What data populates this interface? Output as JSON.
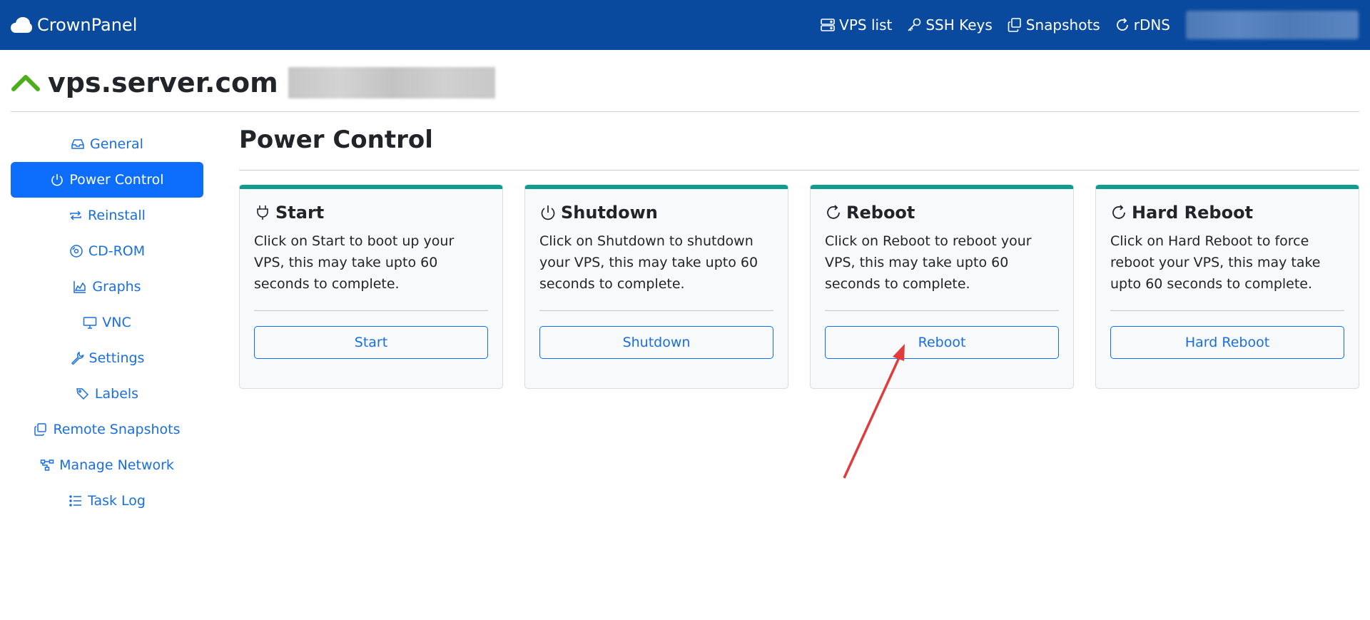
{
  "app": {
    "name": "CrownPanel"
  },
  "nav": {
    "links": [
      {
        "label": "VPS list",
        "icon": "server-icon"
      },
      {
        "label": "SSH Keys",
        "icon": "key-icon"
      },
      {
        "label": "Snapshots",
        "icon": "copy-icon"
      },
      {
        "label": "rDNS",
        "icon": "refresh-icon"
      }
    ]
  },
  "server": {
    "hostname": "vps.server.com",
    "status_icon": "chevron-up-icon",
    "status_color": "#4caf1a"
  },
  "sidebar": {
    "items": [
      {
        "label": "General",
        "icon": "inbox-icon"
      },
      {
        "label": "Power Control",
        "icon": "power-icon",
        "active": true
      },
      {
        "label": "Reinstall",
        "icon": "repeat-icon"
      },
      {
        "label": "CD-ROM",
        "icon": "disc-icon"
      },
      {
        "label": "Graphs",
        "icon": "area-chart-icon"
      },
      {
        "label": "VNC",
        "icon": "monitor-icon"
      },
      {
        "label": "Settings",
        "icon": "wrench-icon"
      },
      {
        "label": "Labels",
        "icon": "tags-icon"
      },
      {
        "label": "Remote Snapshots",
        "icon": "copy-icon"
      },
      {
        "label": "Manage Network",
        "icon": "diagram-icon"
      },
      {
        "label": "Task Log",
        "icon": "list-icon"
      }
    ]
  },
  "main": {
    "title": "Power Control",
    "cards": [
      {
        "title": "Start",
        "icon": "plug-icon",
        "text": "Click on Start to boot up your VPS, this may take upto 60 seconds to complete.",
        "button": "Start"
      },
      {
        "title": "Shutdown",
        "icon": "power-icon",
        "text": "Click on Shutdown to shutdown your VPS, this may take upto 60 seconds to complete.",
        "button": "Shutdown"
      },
      {
        "title": "Reboot",
        "icon": "refresh-icon",
        "text": "Click on Reboot to reboot your VPS, this may take upto 60 seconds to complete.",
        "button": "Reboot"
      },
      {
        "title": "Hard Reboot",
        "icon": "refresh-icon",
        "text": "Click on Hard Reboot to force reboot your VPS, this may take upto 60 seconds to complete.",
        "button": "Hard Reboot"
      }
    ]
  },
  "colors": {
    "navbar": "#0a4a9e",
    "accent": "#0d6efd",
    "card_top": "#0f9d8f",
    "annotation_arrow": "#e03c3c"
  }
}
